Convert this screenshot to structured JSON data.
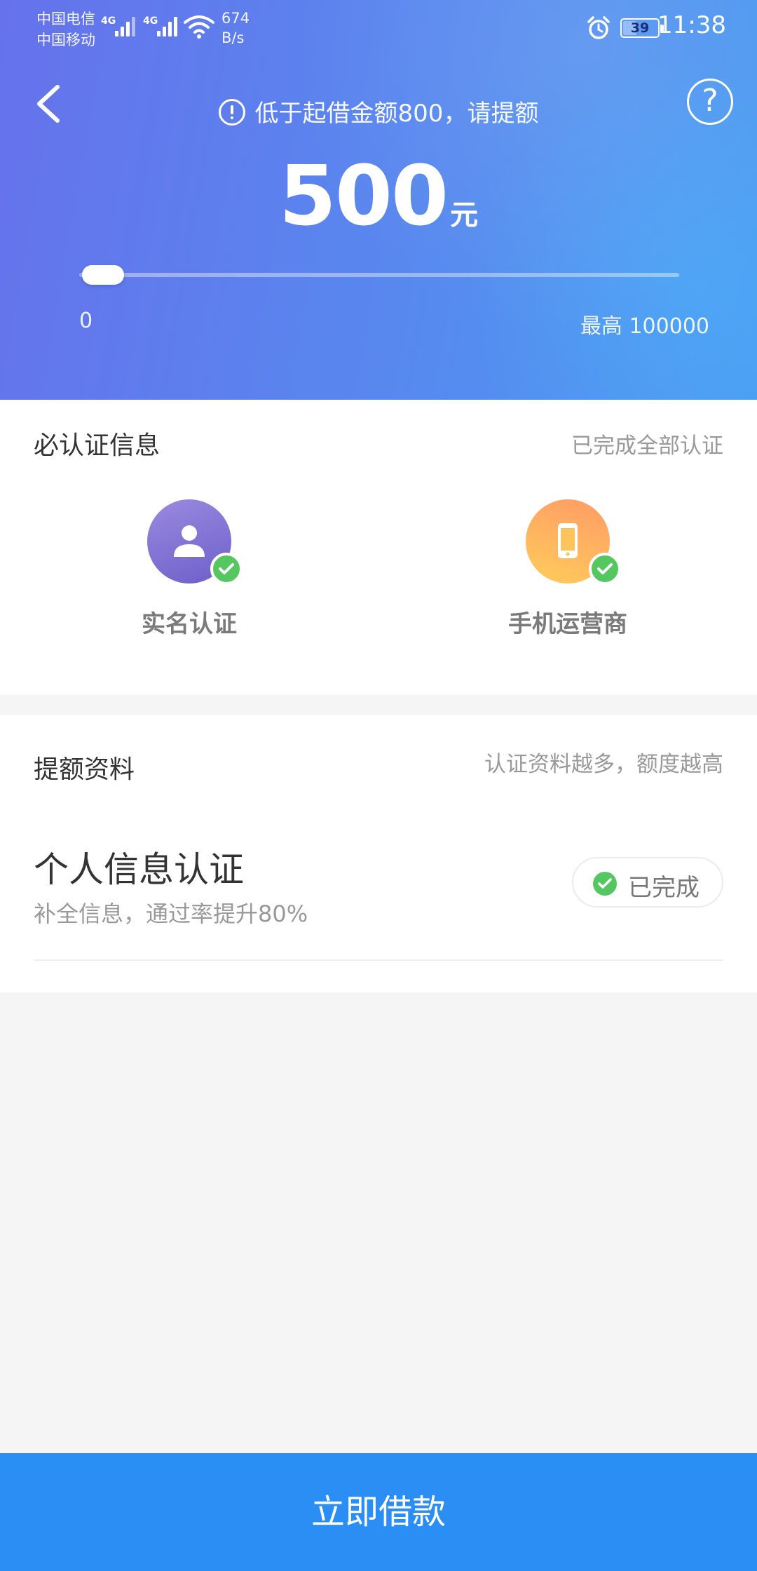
{
  "status_bar": {
    "carrier_1": "中国电信",
    "carrier_2": "中国移动",
    "signal_tag": "4G",
    "net_speed_value": "674",
    "net_speed_unit": "B/s",
    "battery_level": "39",
    "time": "11:38"
  },
  "header": {
    "notice": "低于起借金额800，请提额",
    "amount": "500",
    "amount_unit": "元",
    "slider": {
      "min": 0,
      "max": 100000,
      "value": 500
    },
    "range_min_label": "0",
    "range_max_label": "最高 100000"
  },
  "required_section": {
    "title": "必认证信息",
    "status": "已完成全部认证",
    "items": [
      {
        "label": "实名认证",
        "icon": "person-icon",
        "color": "#7c6ed6",
        "verified": true
      },
      {
        "label": "手机运营商",
        "icon": "phone-icon",
        "color": "#ffb25c",
        "verified": true
      }
    ]
  },
  "boost_section": {
    "title": "提额资料",
    "hint": "认证资料越多，额度越高",
    "items": [
      {
        "title": "个人信息认证",
        "desc": "补全信息，通过率提升80%",
        "status": "已完成"
      }
    ]
  },
  "footer": {
    "button_label": "立即借款"
  },
  "colors": {
    "header_gradient_start": "#6672ec",
    "header_gradient_end": "#4b9bf1",
    "button_blue": "#2a8ef5",
    "check_green": "#55c760"
  }
}
